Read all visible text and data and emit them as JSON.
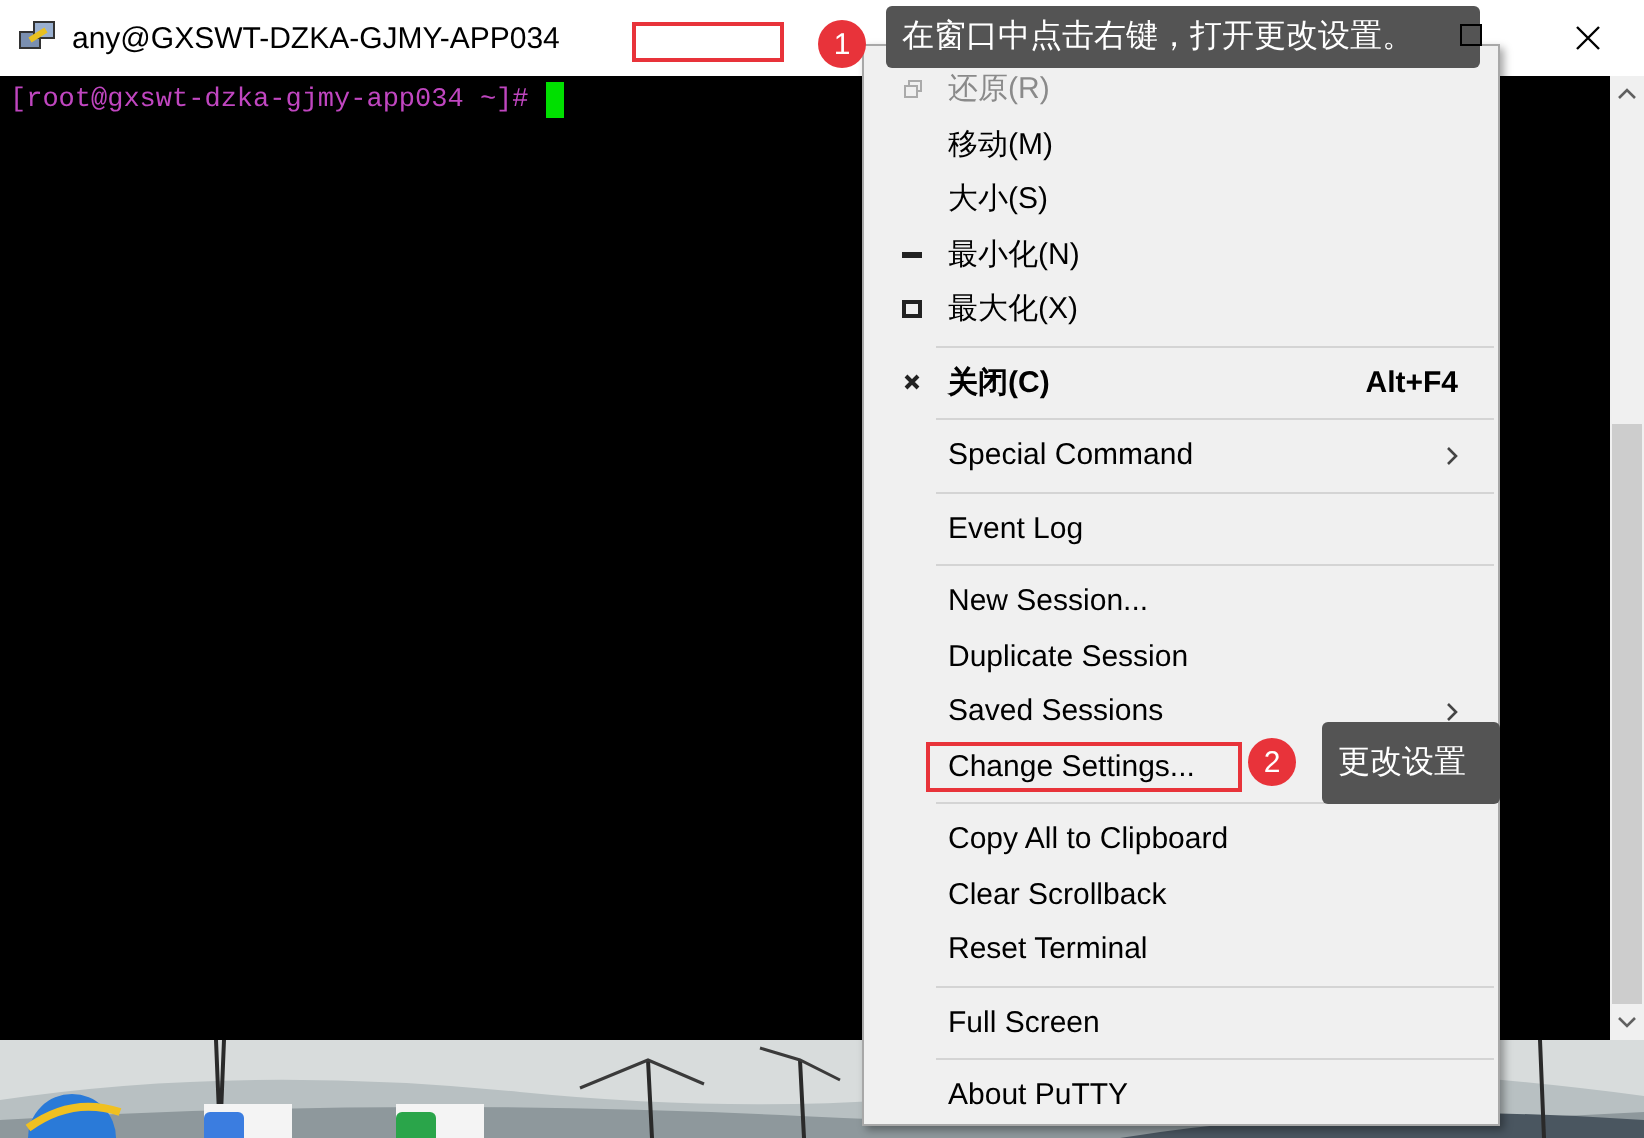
{
  "window": {
    "title": "any@GXSWT-DZKA-GJMY-APP034",
    "highlight_box": true
  },
  "terminal": {
    "prompt": "[root@gxswt-dzka-gjmy-app034 ~]#"
  },
  "menu": {
    "items": [
      {
        "kind": "restore",
        "label": "还原(R)",
        "disabled": true,
        "default": false,
        "marked": false
      },
      {
        "kind": "plain",
        "label": "移动(M)",
        "disabled": false,
        "default": false,
        "marked": false
      },
      {
        "kind": "plain",
        "label": "大小(S)",
        "disabled": false,
        "default": false,
        "marked": false
      },
      {
        "kind": "minimize",
        "label": "最小化(N)",
        "disabled": false,
        "default": false,
        "marked": false
      },
      {
        "kind": "maximize",
        "label": "最大化(X)",
        "disabled": false,
        "default": false,
        "marked": false
      },
      {
        "kind": "separator"
      },
      {
        "kind": "close",
        "label": "关闭(C)",
        "shortcut": "Alt+F4",
        "disabled": false,
        "default": true,
        "marked": false
      },
      {
        "kind": "separator"
      },
      {
        "kind": "submenu",
        "label": "Special Command",
        "disabled": false,
        "default": false,
        "marked": false
      },
      {
        "kind": "separator"
      },
      {
        "kind": "plain",
        "label": "Event Log",
        "disabled": false,
        "default": false,
        "marked": false
      },
      {
        "kind": "separator"
      },
      {
        "kind": "plain",
        "label": "New Session...",
        "disabled": false,
        "default": false,
        "marked": false
      },
      {
        "kind": "plain",
        "label": "Duplicate Session",
        "disabled": false,
        "default": false,
        "marked": false
      },
      {
        "kind": "submenu",
        "label": "Saved Sessions",
        "disabled": false,
        "default": false,
        "marked": false
      },
      {
        "kind": "plain",
        "label": "Change Settings...",
        "disabled": false,
        "default": false,
        "marked": true
      },
      {
        "kind": "separator"
      },
      {
        "kind": "plain",
        "label": "Copy All to Clipboard",
        "disabled": false,
        "default": false,
        "marked": false
      },
      {
        "kind": "plain",
        "label": "Clear Scrollback",
        "disabled": false,
        "default": false,
        "marked": false
      },
      {
        "kind": "plain",
        "label": "Reset Terminal",
        "disabled": false,
        "default": false,
        "marked": false
      },
      {
        "kind": "separator"
      },
      {
        "kind": "plain",
        "label": "Full Screen",
        "disabled": false,
        "default": false,
        "marked": false
      },
      {
        "kind": "separator"
      },
      {
        "kind": "plain",
        "label": "About PuTTY",
        "disabled": false,
        "default": false,
        "marked": false
      }
    ]
  },
  "annotations": [
    {
      "badge": "1",
      "text": "在窗口中点击右键，打开更改设置。"
    },
    {
      "badge": "2",
      "text": "更改设置"
    }
  ]
}
